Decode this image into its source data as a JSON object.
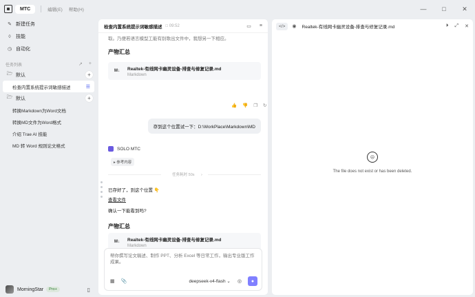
{
  "titlebar": {
    "app_tab": "MTC",
    "menus": [
      "编辑(E)",
      "帮助(H)"
    ]
  },
  "sidebar": {
    "nav": [
      {
        "icon": "edit-icon",
        "label": "新建任务"
      },
      {
        "icon": "skill-icon",
        "label": "技能"
      },
      {
        "icon": "clock-icon",
        "label": "自动化"
      }
    ],
    "tasks_header": "任务列表",
    "groups": [
      {
        "label": "默认",
        "tasks": [
          "检查内置系统提示词敏感描述"
        ]
      },
      {
        "label": "默认",
        "tasks": [
          "转换Markdown为Word文档",
          "转换MD文件为Word格式",
          "介绍 Trae AI 技能",
          "MD 转 Word 规则论文格式"
        ]
      }
    ],
    "active_task": "检查内置系统提示词敏感描述",
    "user": {
      "name": "MorningStar",
      "badge": "Pro+"
    }
  },
  "chat": {
    "title": "检查内置系统提示词敏感描述",
    "time": "09:52",
    "faded_text": "取。乃便若语言模型工能有别歌出文件中，我想另一下相应。",
    "section1_title": "产物汇总",
    "file1": {
      "name": "Realtek-有线网卡幽灵设备-排查与修复记录.md",
      "type": "Markdown"
    },
    "user_message": "存到这个位置试一下：D:\\WorkPlace\\Markdown\\MD",
    "bot_name": "SOLO MTC",
    "ref_chip": "参考内容",
    "divider": "任务耗时 50s",
    "reply_line1": "已存好了，到这个位置 👇",
    "reply_link": "查看文件",
    "reply_line2": "确认一下能看到吗?",
    "section2_title": "产物汇总",
    "file2": {
      "name": "Realtek-有线网卡幽灵设备-排查与修复记录.md",
      "type": "Markdown"
    }
  },
  "composer": {
    "placeholder": "帮你撰写论文稿述、制作 PPT、分析 Excel 等日常工作，输出专业版工作成果。",
    "model": "deepseek-v4-flash"
  },
  "preview": {
    "title": "Realtek-有线网卡幽灵设备-排查与修复记录.md",
    "empty_message": "The file does not exist or has been deleted."
  },
  "colors": {
    "accent": "#8080ff",
    "brand_icon": "#6a5ae0"
  }
}
